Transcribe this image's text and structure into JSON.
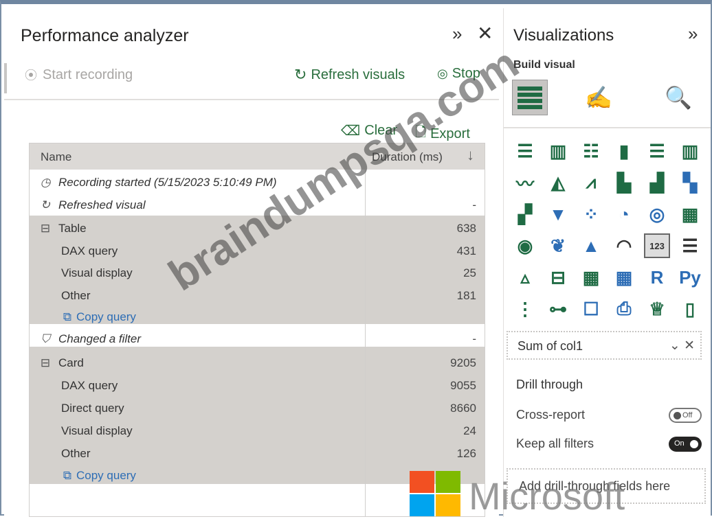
{
  "performance_analyzer": {
    "title": "Performance analyzer",
    "expand_icon": "»",
    "close_icon": "✕",
    "start_recording": "Start recording",
    "refresh_visuals": "Refresh visuals",
    "stop": "Stop",
    "clear": "Clear",
    "export": "Export",
    "table": {
      "headers": {
        "name": "Name",
        "duration": "Duration (ms)"
      },
      "rows": [
        {
          "label": "Recording started (5/15/2023 5:10:49 PM)",
          "value": ""
        },
        {
          "label": "Refreshed visual",
          "value": "-"
        },
        {
          "label": "Table",
          "value": "638"
        },
        {
          "label": "DAX query",
          "value": "431"
        },
        {
          "label": "Visual display",
          "value": "25"
        },
        {
          "label": "Other",
          "value": "181"
        },
        {
          "label": "Copy query",
          "value": ""
        },
        {
          "label": "Changed a filter",
          "value": "-"
        },
        {
          "label": "Card",
          "value": "9205"
        },
        {
          "label": "DAX query",
          "value": "9055"
        },
        {
          "label": "Direct query",
          "value": "8660"
        },
        {
          "label": "Visual display",
          "value": "24"
        },
        {
          "label": "Other",
          "value": "126"
        },
        {
          "label": "Copy query",
          "value": ""
        }
      ]
    }
  },
  "visualizations": {
    "title": "Visualizations",
    "expand_icon": "»",
    "build_visual": "Build visual",
    "field_well": "Sum of col1",
    "drill_through": "Drill through",
    "cross_report": "Cross-report",
    "cross_report_state": "Off",
    "keep_all_filters": "Keep all filters",
    "keep_all_filters_state": "On",
    "drop_zone": "Add drill-through fields here"
  },
  "watermark": "braindumpsqa.com",
  "ms_logo_text": "Microsoft",
  "colors": {
    "accent_green": "#2a6e3d",
    "link_blue": "#2d6db5",
    "group_bg": "#d4d1cd"
  }
}
